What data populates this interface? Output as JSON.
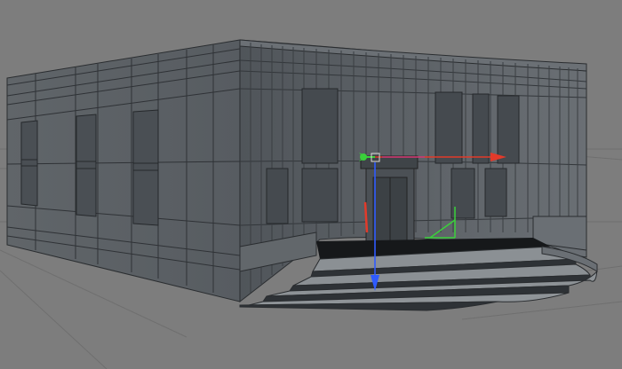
{
  "viewport": {
    "background": "#7d7d7d",
    "grid_color": "#6e6e6e"
  },
  "model": {
    "face_color": "#5c6166",
    "face_dark": "#474c51",
    "wire_color": "#2a2d30",
    "window_color": "#3a3f44",
    "ground_color": "#16181a"
  },
  "gizmo": {
    "x_axis_color": "#e23a2a",
    "y_axis_color": "#3ad13a",
    "z_axis_color": "#2f5bff",
    "rotate_handle_color": "#c63a86",
    "pivot_icon": "move-gizmo-icon"
  }
}
